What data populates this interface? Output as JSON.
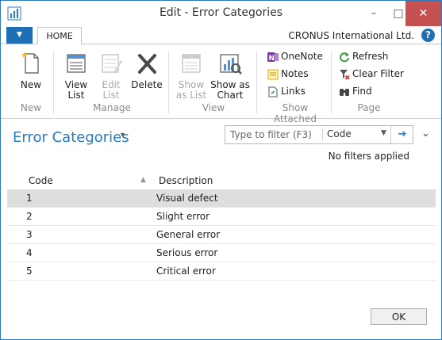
{
  "window": {
    "title": "Edit - Error Categories",
    "minimize": "–",
    "maximize": "□",
    "close": "✕"
  },
  "ribbon_tabs": {
    "app_menu_icon": "▼",
    "home": "HOME",
    "company": "CRONUS International Ltd.",
    "help": "?"
  },
  "ribbon": {
    "new": "New",
    "view_list": "View List",
    "edit_list": "Edit List",
    "delete": "Delete",
    "show_as_list": "Show as List",
    "show_as_chart": "Show as Chart",
    "onenote": "OneNote",
    "notes": "Notes",
    "links": "Links",
    "refresh": "Refresh",
    "clear_filter": "Clear Filter",
    "find": "Find",
    "groups": {
      "new": "New",
      "manage": "Manage",
      "view": "View",
      "show_attached": "Show Attached",
      "page": "Page"
    }
  },
  "page": {
    "title": "Error Categories",
    "title_chevron": "▾",
    "collapse": "⌄"
  },
  "filter": {
    "placeholder": "Type to filter (F3)",
    "field": "Code",
    "dropdown": "▼",
    "go": "➔",
    "status": "No filters applied"
  },
  "table": {
    "headers": {
      "code": "Code",
      "description": "Description",
      "sort_indicator": "▲"
    },
    "rows": [
      {
        "code": "1",
        "description": "Visual defect"
      },
      {
        "code": "2",
        "description": "Slight error"
      },
      {
        "code": "3",
        "description": "General error"
      },
      {
        "code": "4",
        "description": "Serious error"
      },
      {
        "code": "5",
        "description": "Critical error"
      }
    ]
  },
  "footer": {
    "ok": "OK"
  },
  "colors": {
    "accent": "#2a7bbf",
    "close_button": "#c75050",
    "selected_row": "#dedede",
    "app_menu": "#1f6fb6"
  },
  "icons": {
    "app": "nav-app-icon",
    "new": "new-document-icon",
    "view_list": "view-list-icon",
    "edit_list": "edit-list-icon",
    "delete": "delete-x-icon",
    "show_as_list": "show-as-list-icon",
    "show_as_chart": "show-as-chart-icon",
    "onenote": "onenote-icon",
    "notes": "notes-icon",
    "links": "links-icon",
    "refresh": "refresh-icon",
    "clear_filter": "clear-filter-icon",
    "find": "find-binoculars-icon"
  }
}
